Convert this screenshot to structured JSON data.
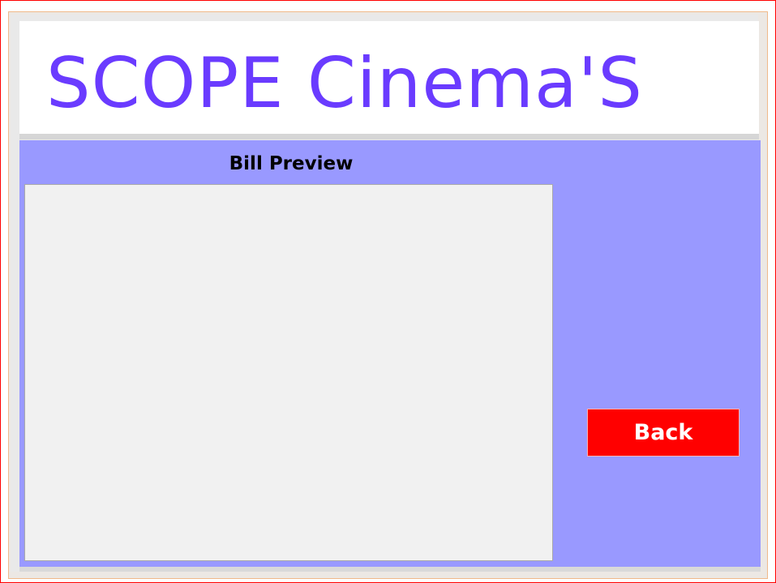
{
  "header": {
    "title": "SCOPE Cinema'S"
  },
  "bill_section": {
    "title": "Bill Preview"
  },
  "actions": {
    "back_label": "Back"
  },
  "colors": {
    "brand_text": "#6a3bff",
    "content_background": "#9999ff",
    "back_button_background": "#ff0000",
    "back_button_text": "#ffffff"
  }
}
